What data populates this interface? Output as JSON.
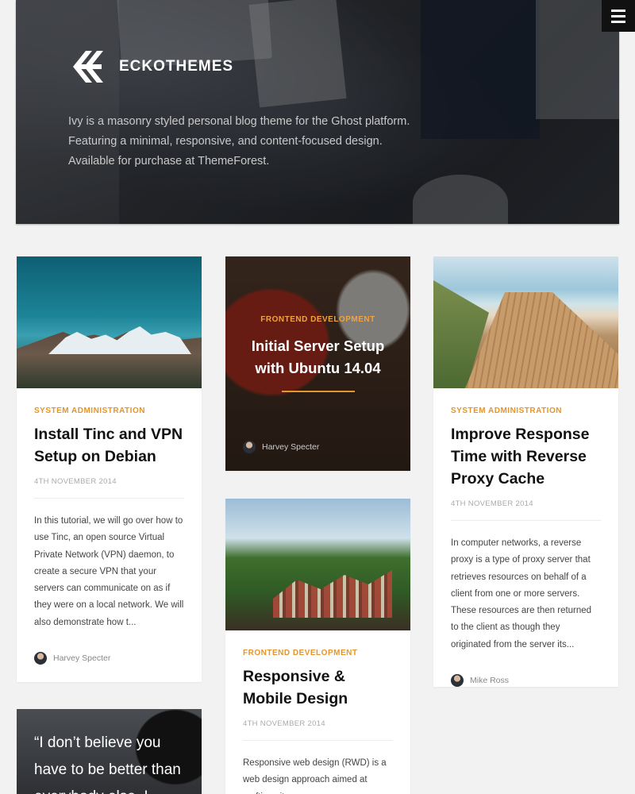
{
  "hero": {
    "brand": "ECKOTHEMES",
    "description": "Ivy is a masonry styled personal blog theme for the Ghost platform. Featuring a minimal, responsive, and content-focused design. Available for purchase at ThemeForest."
  },
  "menu": {
    "icon": "hamburger-menu-icon"
  },
  "posts": [
    {
      "category": "SYSTEM ADMINISTRATION",
      "title": "Install Tinc and VPN Setup on Debian",
      "date": "4TH NOVEMBER 2014",
      "excerpt": "In this tutorial, we will go over how to use Tinc, an open source Virtual Private Network (VPN) daemon, to create a secure VPN that your servers can communicate on as if they were on a local network. We will also demonstrate how t...",
      "author": "Harvey Specter"
    },
    {
      "category": "FRONTEND DEVELOPMENT",
      "title": "Initial Server Setup with Ubuntu 14.04",
      "author": "Harvey Specter"
    },
    {
      "category": "SYSTEM ADMINISTRATION",
      "title": "Improve Response Time with Reverse Proxy Cache",
      "date": "4TH NOVEMBER 2014",
      "excerpt": "In computer networks, a reverse proxy is a type of proxy server that retrieves resources on behalf of a client from one or more servers. These resources are then returned to the client as though they originated from the server its...",
      "author": "Mike Ross"
    },
    {
      "category": "FRONTEND DEVELOPMENT",
      "title": "Responsive & Mobile Design",
      "date": "4TH NOVEMBER 2014",
      "excerpt": "Responsive web design (RWD) is a web design approach aimed at crafting sites"
    }
  ],
  "quote": {
    "text": "“I don’t believe you have to be better than everybody else. I"
  }
}
